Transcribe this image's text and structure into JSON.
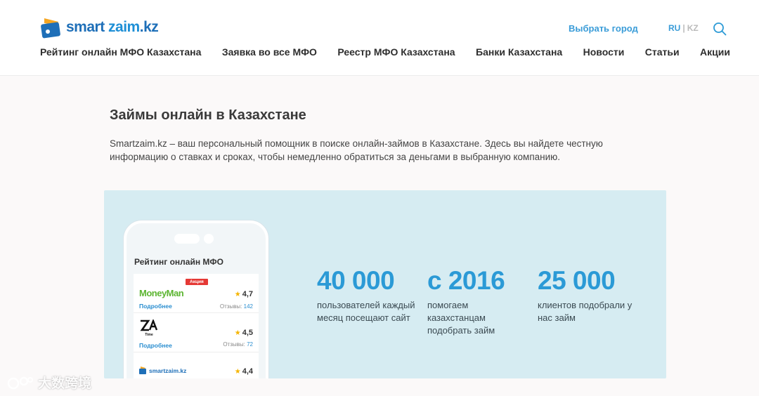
{
  "header": {
    "logo": {
      "part1": "smart",
      "part2": "zaim",
      "part3": ".kz"
    },
    "city_label": "Выбрать город",
    "lang": {
      "ru": "RU",
      "separator": "|",
      "kz": "KZ"
    },
    "nav": [
      "Рейтинг онлайн МФО Казахстана",
      "Заявка во все МФО",
      "Реестр МФО Казахстана",
      "Банки Казахстана",
      "Новости",
      "Статьи",
      "Акции"
    ]
  },
  "main": {
    "title": "Займы онлайн в Казахстане",
    "intro": "Smartzaim.kz – ваш персональный помощник в поиске онлайн-займов в Казахстане. Здесь вы найдете честную информацию о ставках и сроках, чтобы немедленно обратиться за деньгами в выбранную компанию."
  },
  "banner": {
    "phone": {
      "title": "Рейтинг онлайн МФО",
      "items": [
        {
          "name": "MoneyMan",
          "badge": "Акция",
          "more": "Подробнее",
          "rating": "4,7",
          "reviews_label": "Отзывы:",
          "reviews": "142"
        },
        {
          "name": "ZA Time",
          "more": "Подробнее",
          "rating": "4,5",
          "reviews_label": "Отзывы:",
          "reviews": "72"
        },
        {
          "name": "smartzaim.kz",
          "rating": "4,4"
        }
      ]
    },
    "stats": [
      {
        "number": "40 000",
        "desc": "пользователей каждый месяц посещают сайт"
      },
      {
        "number": "с 2016",
        "desc": "помогаем казахстанцам подобрать займ"
      },
      {
        "number": "25 000",
        "desc": "клиентов подобрали у нас займ"
      }
    ]
  },
  "watermark": "大数跨境",
  "colors": {
    "accent": "#2b9ad6",
    "banner_bg": "#d6ecf2",
    "promo": "#e53935",
    "star": "#f5b400"
  }
}
